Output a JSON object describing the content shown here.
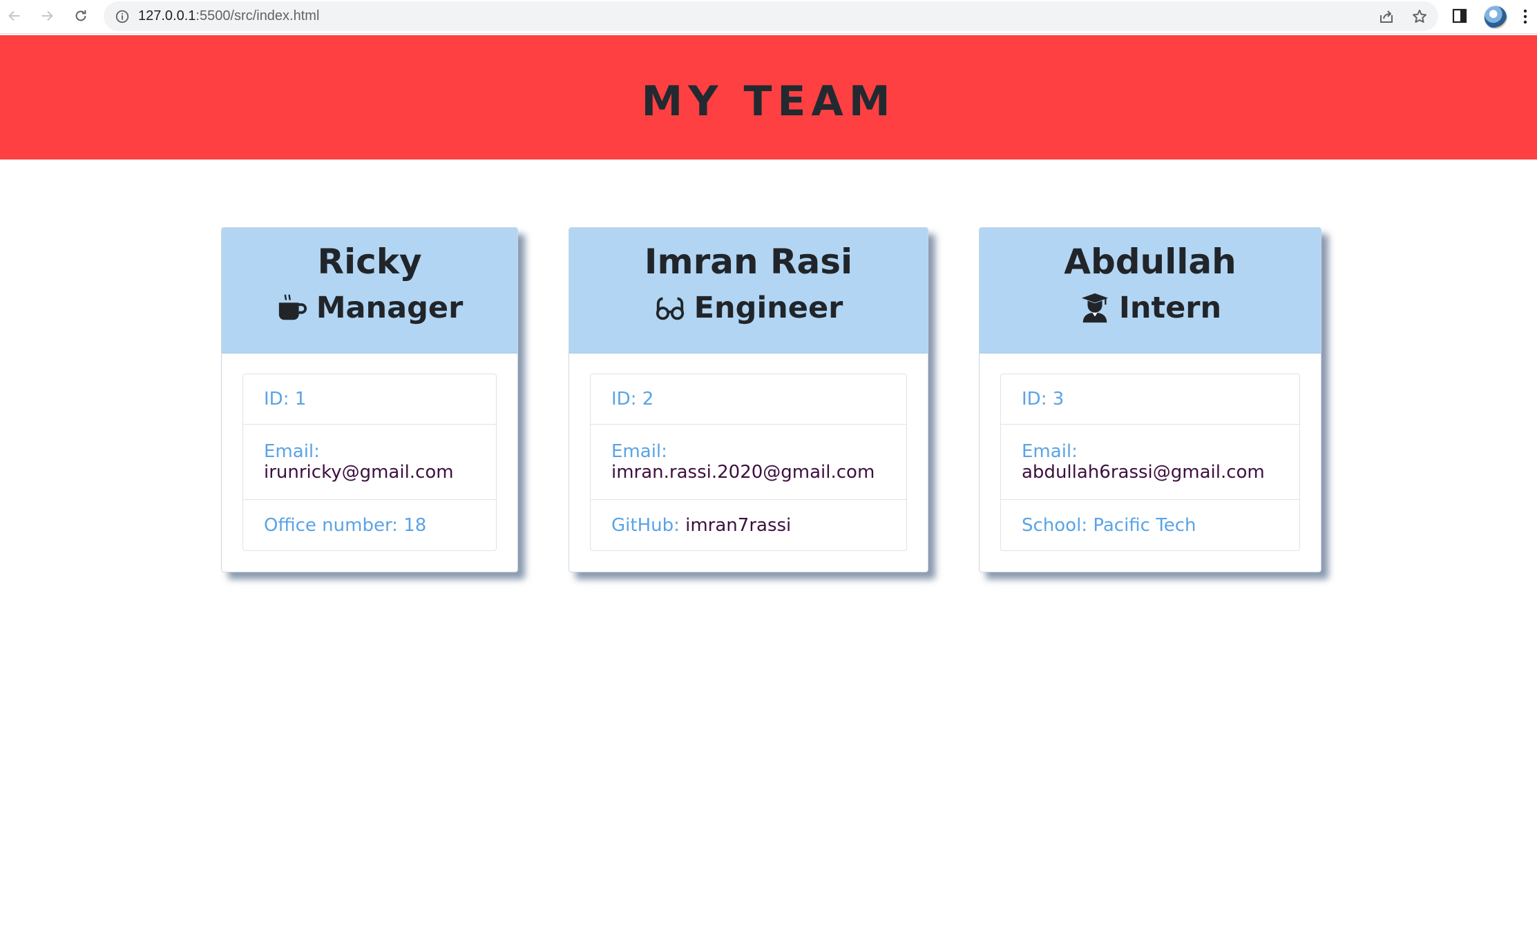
{
  "browser": {
    "url_host": "127.0.0.1",
    "url_rest": ":5500/src/index.html"
  },
  "header": {
    "title": "MY TEAM"
  },
  "colors": {
    "header_bg": "#ff4043",
    "card_header_bg": "#b2d5f3",
    "label": "#5aa3e6",
    "link": "#3d0f3f"
  },
  "cards": [
    {
      "name": "Ricky",
      "role": "Manager",
      "role_icon": "coffee-mug-icon",
      "id_text": "ID: 1",
      "email_label": "Email:",
      "email": "irunricky@gmail.com",
      "extra_label": "Office number: 18",
      "extra_value": ""
    },
    {
      "name": "Imran Rasi",
      "role": "Engineer",
      "role_icon": "glasses-icon",
      "id_text": "ID: 2",
      "email_label": "Email:",
      "email": "imran.rassi.2020@gmail.com",
      "extra_label": "GitHub:",
      "extra_value": "imran7rassi"
    },
    {
      "name": "Abdullah",
      "role": "Intern",
      "role_icon": "graduate-icon",
      "id_text": "ID: 3",
      "email_label": "Email:",
      "email": "abdullah6rassi@gmail.com",
      "extra_label": "School: Pacific Tech",
      "extra_value": ""
    }
  ]
}
